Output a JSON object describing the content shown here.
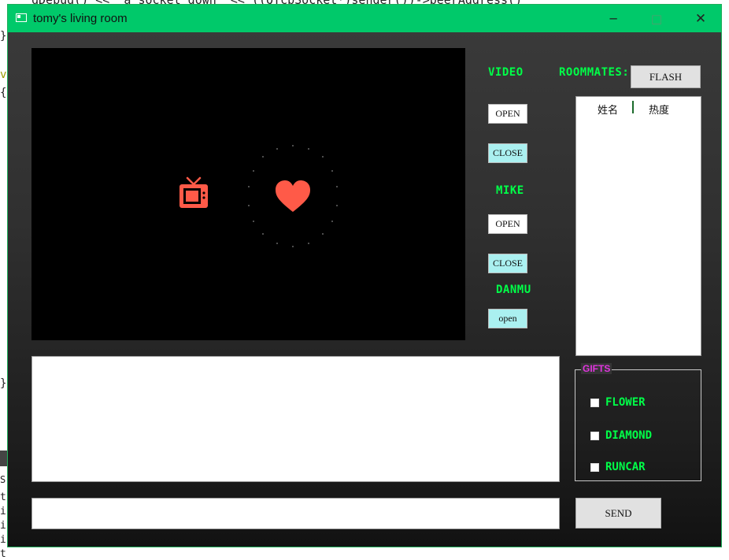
{
  "background": {
    "code_line": "qDebug() << \"a socket down\" << ((QTcpSocket*)sender())->peerAddress()",
    "left_chars": [
      "}",
      "v",
      "{",
      "}",
      "t",
      "i",
      "i",
      "i",
      "t",
      "S"
    ]
  },
  "window": {
    "title": "tomy's living room",
    "minimize_glyph": "─",
    "maximize_glyph": "□",
    "close_glyph": "✕"
  },
  "controls": {
    "video_label": "VIDEO",
    "video_open": "OPEN",
    "video_close": "CLOSE",
    "mike_label": "MIKE",
    "mike_open": "OPEN",
    "mike_close": "CLOSE",
    "danmu_label": "DANMU",
    "danmu_open": "open"
  },
  "roommates": {
    "label": "ROOMMATES:",
    "flash_button": "FLASH",
    "columns": [
      "姓名",
      "热度"
    ],
    "rows": []
  },
  "chat": {
    "messages": [],
    "input_value": "",
    "send_button": "SEND"
  },
  "gifts": {
    "title": "GIFTS",
    "items": [
      {
        "label": "FLOWER",
        "checked": false
      },
      {
        "label": "DIAMOND",
        "checked": false
      },
      {
        "label": "RUNCAR",
        "checked": false
      }
    ]
  },
  "icons": {
    "tv": "tv-icon",
    "heart": "heart-icon"
  },
  "colors": {
    "titlebar": "#00c96a",
    "label_green": "#00ff48",
    "icon_red": "#ff5a48",
    "gifts_title": "#e234e0",
    "button_cyan": "#aaf0f0"
  }
}
